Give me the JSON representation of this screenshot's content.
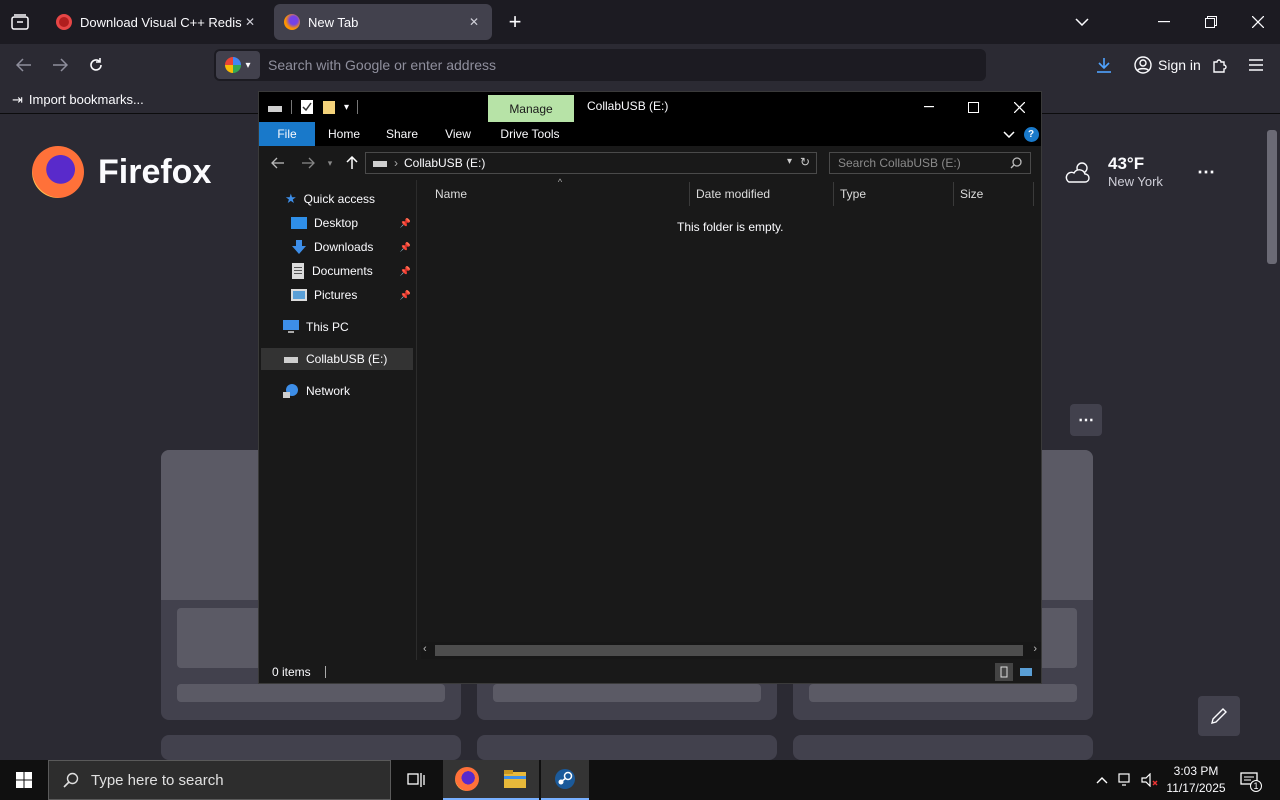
{
  "browser": {
    "tabs": [
      {
        "title": "Download Visual C++ Redistrib"
      },
      {
        "title": "New Tab"
      }
    ],
    "url_placeholder": "Search with Google or enter address",
    "sign_in_label": "Sign in",
    "import_bookmarks_label": "Import bookmarks..."
  },
  "newtab": {
    "brand": "Firefox",
    "weather": {
      "temp": "43°F",
      "city": "New York"
    }
  },
  "explorer": {
    "manage_label": "Manage",
    "window_title": "CollabUSB (E:)",
    "ribbon_tabs": [
      "File",
      "Home",
      "Share",
      "View",
      "Drive Tools"
    ],
    "address_path": "CollabUSB (E:)",
    "search_placeholder": "Search CollabUSB (E:)",
    "nav": {
      "quick_access": "Quick access",
      "pinned": [
        "Desktop",
        "Downloads",
        "Documents",
        "Pictures"
      ],
      "this_pc": "This PC",
      "drive": "CollabUSB (E:)",
      "network": "Network"
    },
    "columns": [
      "Name",
      "Date modified",
      "Type",
      "Size"
    ],
    "empty_message": "This folder is empty.",
    "status": "0 items"
  },
  "taskbar": {
    "search_placeholder": "Type here to search",
    "time": "3:03 PM",
    "date": "11/17/2025",
    "notification_count": "1"
  },
  "colors": {
    "file_tab": "#1979ca",
    "manage_tab": "#b7e3a7",
    "selection": "#333333",
    "taskbar_accent": "#78b0ff"
  }
}
